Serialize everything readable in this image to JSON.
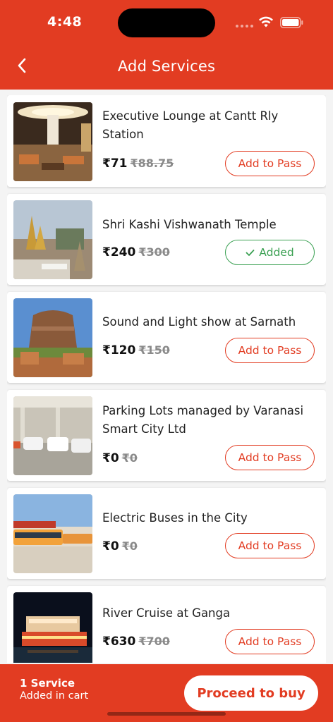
{
  "status": {
    "time": "4:48"
  },
  "header": {
    "title": "Add Services",
    "back_icon": "chevron-left-icon"
  },
  "services": [
    {
      "name": "Executive Lounge at Cantt Rly Station",
      "price": "₹71",
      "old_price": "₹88.75",
      "action": "Add to Pass",
      "added": false
    },
    {
      "name": "Shri Kashi Vishwanath Temple",
      "price": "₹240",
      "old_price": "₹300",
      "action": "Added",
      "added": true
    },
    {
      "name": "Sound and Light show at Sarnath",
      "price": "₹120",
      "old_price": "₹150",
      "action": "Add to Pass",
      "added": false
    },
    {
      "name": "Parking Lots managed by Varanasi Smart City Ltd",
      "price": "₹0",
      "old_price": "₹0",
      "action": "Add to Pass",
      "added": false
    },
    {
      "name": "Electric Buses in the City",
      "price": "₹0",
      "old_price": "₹0",
      "action": "Add to Pass",
      "added": false
    },
    {
      "name": "River Cruise at Ganga",
      "price": "₹630",
      "old_price": "₹700",
      "action": "Add to Pass",
      "added": false
    }
  ],
  "cart": {
    "count_label": "1 Service",
    "sub_label": "Added in cart",
    "proceed_label": "Proceed to buy"
  },
  "colors": {
    "brand": "#e23c22",
    "added": "#3aa052"
  }
}
